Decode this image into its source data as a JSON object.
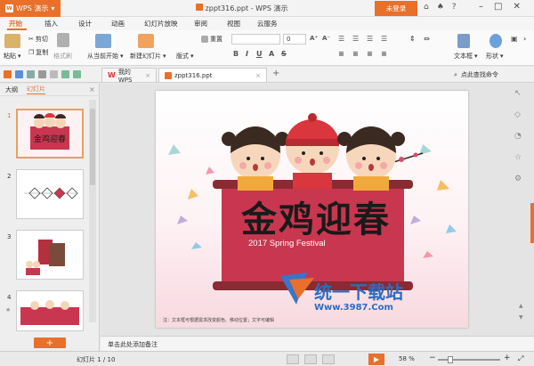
{
  "app": {
    "name": "WPS 演示",
    "logo_letter": "W"
  },
  "window": {
    "title": "zppt316.ppt - WPS 演示",
    "login": "未登录"
  },
  "menu": [
    "开始",
    "插入",
    "设计",
    "动画",
    "幻灯片放映",
    "审阅",
    "视图",
    "云服务"
  ],
  "ribbon": {
    "paste": "粘贴",
    "cut": "剪切",
    "copy": "复制",
    "format_painter": "格式刷",
    "from_current": "从当前开始",
    "new_slide": "新建幻灯片",
    "layout": "版式",
    "reset": "重置",
    "font_size": "0",
    "textbox": "文本框",
    "shape": "形状"
  },
  "tabs": {
    "tab1": "我的WPS",
    "tab2": "zppt316.ppt",
    "help": "点此查找命令"
  },
  "left_panel": {
    "tab_outline": "大纲",
    "tab_slides": "幻灯片",
    "slide_numbers": [
      "1",
      "2",
      "3",
      "4"
    ]
  },
  "slide": {
    "title": "金鸡迎春",
    "subtitle": "2017 Spring Festival",
    "footnote": "注：文本框可根据需求改变颜色、移动位置；文字可编辑",
    "watermark_cn": "统一下载站",
    "watermark_url": "Www.3987.Com"
  },
  "notes": {
    "placeholder": "单击此处添加备注"
  },
  "status": {
    "page": "幻灯片 1 / 10",
    "zoom": "58 %"
  },
  "colors": {
    "accent": "#e8702a",
    "banner": "#c8374f"
  }
}
